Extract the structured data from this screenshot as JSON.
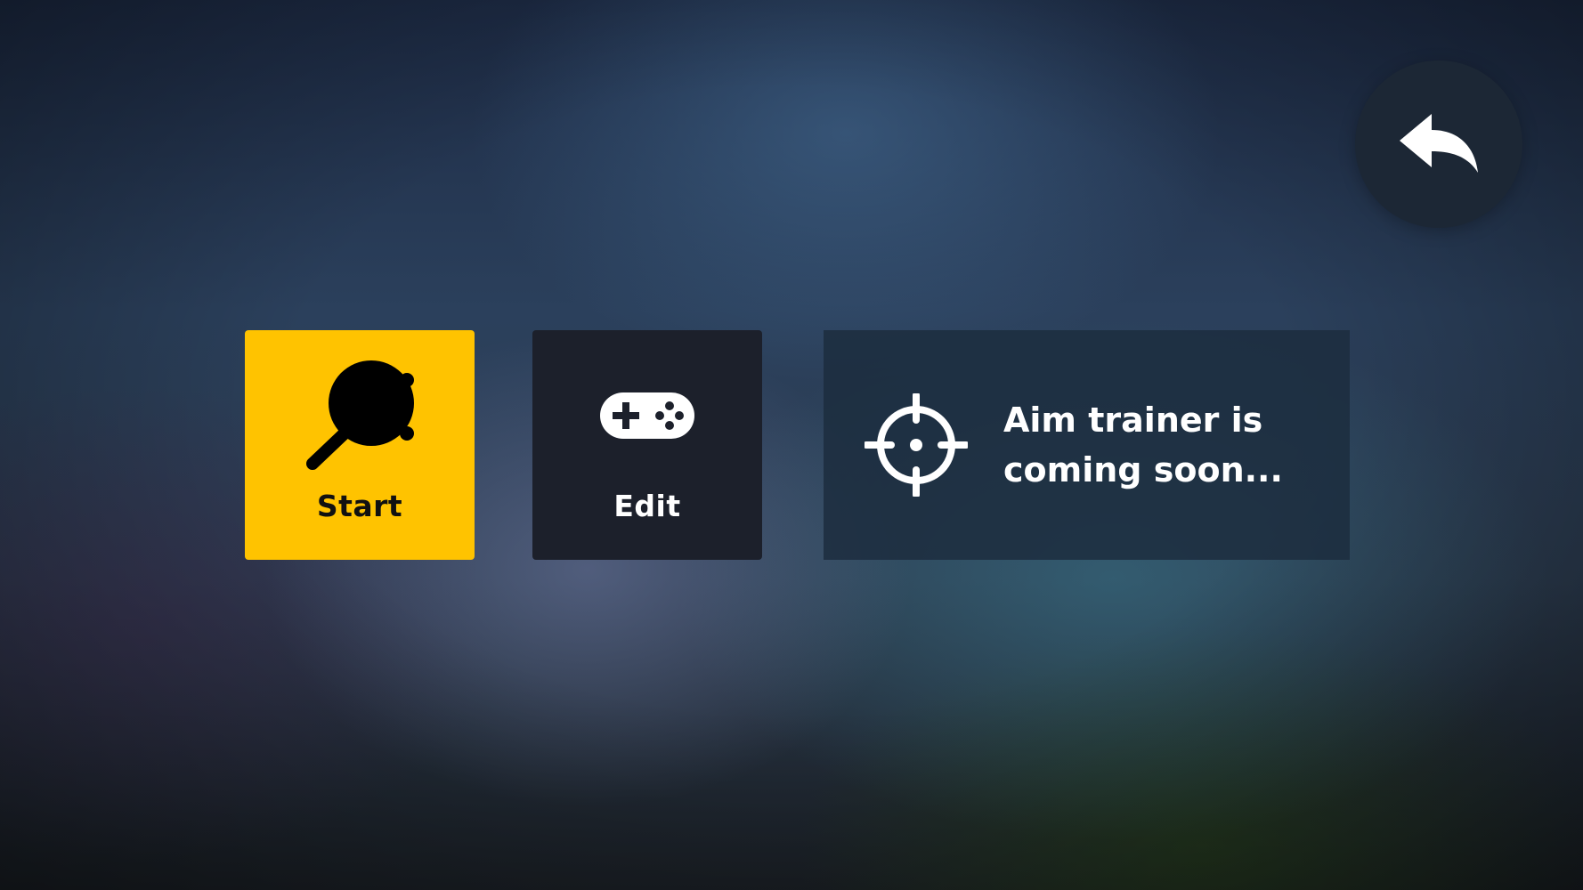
{
  "menu": {
    "back_button": {
      "icon": "reply-arrow-icon"
    },
    "start": {
      "label": "Start",
      "icon": "frying-pan-icon",
      "color": "#ffc300"
    },
    "edit": {
      "label": "Edit",
      "icon": "gamepad-icon",
      "color": "#1c202b"
    },
    "aim_trainer": {
      "message": "Aim trainer is coming soon...",
      "icon": "crosshair-icon"
    }
  }
}
